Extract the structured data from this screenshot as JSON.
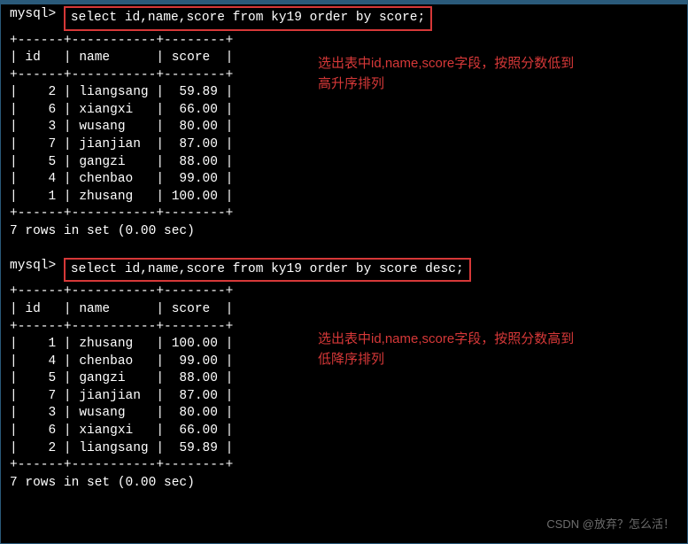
{
  "prompt": "mysql>",
  "query1": "select id,name,score from ky19 order by score;",
  "note1_line1": "选出表中id,name,score字段，按照分数低到",
  "note1_line2": "高升序排列",
  "table1": {
    "sep": "+------+-----------+--------+",
    "header": "| id   | name      | score  |",
    "rows": [
      "|    2 | liangsang |  59.89 |",
      "|    6 | xiangxi   |  66.00 |",
      "|    3 | wusang    |  80.00 |",
      "|    7 | jianjian  |  87.00 |",
      "|    5 | gangzi    |  88.00 |",
      "|    4 | chenbao   |  99.00 |",
      "|    1 | zhusang   | 100.00 |"
    ]
  },
  "footer1": "7 rows in set (0.00 sec)",
  "query2": "select id,name,score from ky19 order by score desc;",
  "note2_line1": "选出表中id,name,score字段，按照分数高到",
  "note2_line2": "低降序排列",
  "table2": {
    "sep": "+------+-----------+--------+",
    "header": "| id   | name      | score  |",
    "rows": [
      "|    1 | zhusang   | 100.00 |",
      "|    4 | chenbao   |  99.00 |",
      "|    5 | gangzi    |  88.00 |",
      "|    7 | jianjian  |  87.00 |",
      "|    3 | wusang    |  80.00 |",
      "|    6 | xiangxi   |  66.00 |",
      "|    2 | liangsang |  59.89 |"
    ]
  },
  "footer2": "7 rows in set (0.00 sec)",
  "watermark": "CSDN @放弃？怎么活！"
}
